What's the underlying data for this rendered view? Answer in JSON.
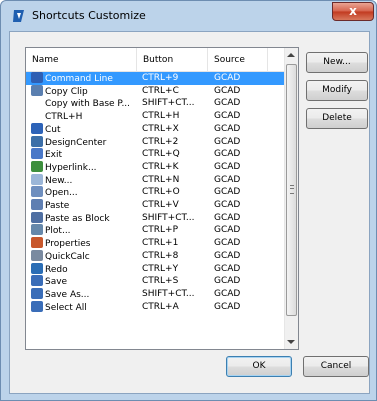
{
  "window": {
    "title": "Shortcuts Customize",
    "close_glyph": "x"
  },
  "columns": {
    "name": "Name",
    "button": "Button",
    "source": "Source"
  },
  "rows": [
    {
      "name": "Command Line",
      "button": "CTRL+9",
      "source": "GCAD",
      "icon": "command-line-icon",
      "color": "#2f5fb3"
    },
    {
      "name": "Copy Clip",
      "button": "CTRL+C",
      "source": "GCAD",
      "icon": "copy-clip-icon",
      "color": "#5a7fb0"
    },
    {
      "name": "Copy with Base P...",
      "button": "SHIFT+CT...",
      "source": "GCAD",
      "icon": "",
      "color": ""
    },
    {
      "name": "CTRL+H",
      "button": "CTRL+H",
      "source": "GCAD",
      "icon": "",
      "color": ""
    },
    {
      "name": "Cut",
      "button": "CTRL+X",
      "source": "GCAD",
      "icon": "cut-icon",
      "color": "#2d63b8"
    },
    {
      "name": "DesignCenter",
      "button": "CTRL+2",
      "source": "GCAD",
      "icon": "designcenter-icon",
      "color": "#3c6fa8"
    },
    {
      "name": "Exit",
      "button": "CTRL+Q",
      "source": "GCAD",
      "icon": "exit-icon",
      "color": "#4a78c8"
    },
    {
      "name": "Hyperlink...",
      "button": "CTRL+K",
      "source": "GCAD",
      "icon": "hyperlink-icon",
      "color": "#3d8f3d"
    },
    {
      "name": "New...",
      "button": "CTRL+N",
      "source": "GCAD",
      "icon": "new-icon",
      "color": "#9bb6d8"
    },
    {
      "name": "Open...",
      "button": "CTRL+O",
      "source": "GCAD",
      "icon": "open-icon",
      "color": "#6f8fbf"
    },
    {
      "name": "Paste",
      "button": "CTRL+V",
      "source": "GCAD",
      "icon": "paste-icon",
      "color": "#5f7fb2"
    },
    {
      "name": "Paste as Block",
      "button": "SHIFT+CT...",
      "source": "GCAD",
      "icon": "paste-block-icon",
      "color": "#4f6fa2"
    },
    {
      "name": "Plot...",
      "button": "CTRL+P",
      "source": "GCAD",
      "icon": "plot-icon",
      "color": "#6688aa"
    },
    {
      "name": "Properties",
      "button": "CTRL+1",
      "source": "GCAD",
      "icon": "properties-icon",
      "color": "#c8572b"
    },
    {
      "name": "QuickCalc",
      "button": "CTRL+8",
      "source": "GCAD",
      "icon": "quickcalc-icon",
      "color": "#7a8aa0"
    },
    {
      "name": "Redo",
      "button": "CTRL+Y",
      "source": "GCAD",
      "icon": "redo-icon",
      "color": "#2a6db5"
    },
    {
      "name": "Save",
      "button": "CTRL+S",
      "source": "GCAD",
      "icon": "save-icon",
      "color": "#3a6db8"
    },
    {
      "name": "Save As...",
      "button": "SHIFT+CT...",
      "source": "GCAD",
      "icon": "save-as-icon",
      "color": "#3a6db8"
    },
    {
      "name": "Select All",
      "button": "CTRL+A",
      "source": "GCAD",
      "icon": "select-all-icon",
      "color": "#3a6db8"
    }
  ],
  "selected_row": 0,
  "buttons": {
    "new": "New...",
    "modify": "Modify",
    "delete": "Delete",
    "ok": "OK",
    "cancel": "Cancel"
  },
  "colors": {
    "selection": "#3399ff",
    "title_bg": "#bcd3ea",
    "close_red": "#c1391f"
  }
}
